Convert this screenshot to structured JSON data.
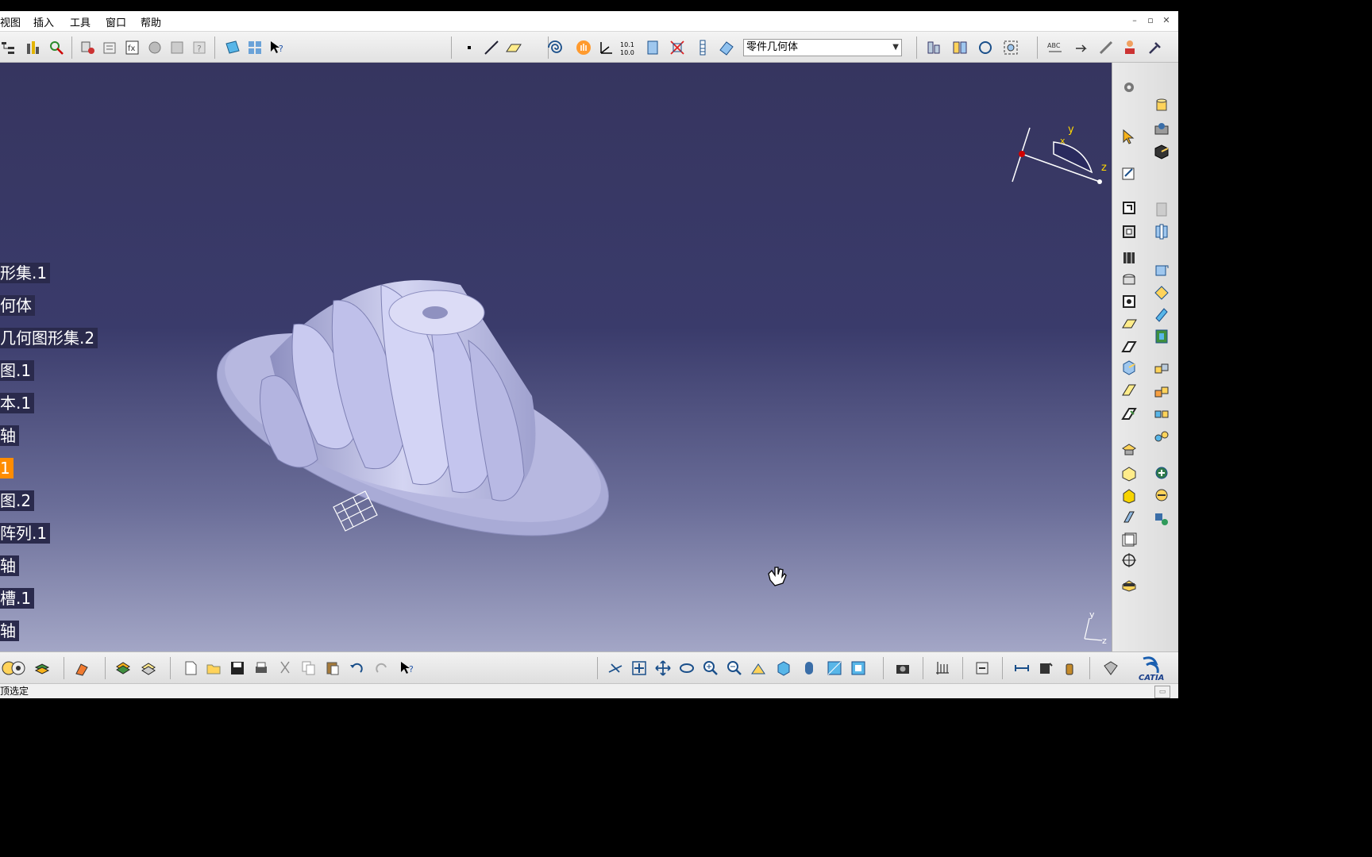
{
  "menu": {
    "items": [
      "视图",
      "插入",
      "工具",
      "窗口",
      "帮助"
    ]
  },
  "window_controls": {
    "minimize": "–",
    "restore": "▫",
    "close": "✕"
  },
  "toolbar_top": {
    "body_selector": {
      "value": "零件几何体"
    }
  },
  "spec_tree": {
    "items": [
      {
        "label": "形集.1"
      },
      {
        "label": "何体"
      },
      {
        "label": "几何图形集.2"
      },
      {
        "label": "图.1"
      },
      {
        "label": "本.1"
      },
      {
        "label": "轴"
      },
      {
        "label": "1",
        "selected": true
      },
      {
        "label": "图.2"
      },
      {
        "label": "阵列.1"
      },
      {
        "label": "轴"
      },
      {
        "label": "槽.1"
      },
      {
        "label": "轴"
      }
    ]
  },
  "compass": {
    "x_label": "x",
    "y_label": "y",
    "z_label": "z"
  },
  "axis_triad": {
    "y_label": "y",
    "z_label": "z"
  },
  "status_bar": {
    "text": "顶选定"
  },
  "brand": {
    "logo_text": "CATIA"
  },
  "colors": {
    "viewport_top": "#36355f",
    "viewport_bottom": "#a3a6c6",
    "part": "#b9bae0",
    "selection": "#ff8c00",
    "tree_label_bg": "#2a2a4c"
  },
  "icons": {
    "top": [
      "tree-expand-icon",
      "bar-analysis-icon",
      "measure-icon",
      "knowledge-icon",
      "parameters-icon",
      "formula-icon",
      "macro-icon",
      "pattern-icon",
      "catalog-icon",
      "help-icon",
      "sketch-icon",
      "matrix-icon",
      "whatsthis-icon",
      "point-icon",
      "line-icon",
      "plane-icon",
      "spiral-icon",
      "hand-icon",
      "axis-icon",
      "coord-value-icon",
      "extrude-icon",
      "rule-icon",
      "stack-icon",
      "solid-icon"
    ],
    "top_right": [
      "assembly-icon",
      "assembly2-icon",
      "rotate-icon",
      "zoom-fit-icon",
      "text-icon",
      "arrow-icon",
      "link-icon",
      "teach-icon",
      "hammer-icon"
    ],
    "bottom": [
      "spec-tree-icon",
      "gear-tree-icon",
      "layers-icon",
      "paint-icon",
      "layer-stack-icon",
      "layer-filter-icon",
      "new-icon",
      "open-icon",
      "save-icon",
      "print-icon",
      "cut-icon",
      "copy-icon",
      "paste-icon",
      "undo-icon",
      "redo-icon",
      "whatsthis-icon",
      "fly-icon",
      "fit-all-icon",
      "pan-icon",
      "rotate-icon",
      "zoom-in-icon",
      "zoom-out-icon",
      "normal-view-icon",
      "iso-view-icon",
      "shading-icon",
      "hide-show-icon",
      "swap-icon",
      "camera-icon",
      "grid-icon",
      "update-icon",
      "measure-between-icon",
      "measure-item-icon",
      "inertia-icon",
      "catia-icon"
    ]
  }
}
